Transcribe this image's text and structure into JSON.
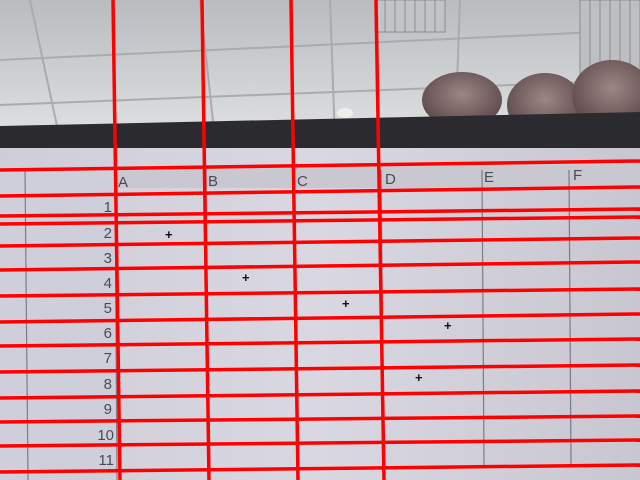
{
  "spreadsheet": {
    "column_headers": [
      "A",
      "B",
      "C",
      "D",
      "E",
      "F"
    ],
    "row_headers": [
      "1",
      "2",
      "3",
      "4",
      "5",
      "6",
      "7",
      "8",
      "9",
      "10",
      "11"
    ],
    "markers": [
      {
        "cell": "A2",
        "symbol": "+"
      },
      {
        "cell": "B4",
        "symbol": "+"
      },
      {
        "cell": "C5",
        "symbol": "+"
      },
      {
        "cell": "D6",
        "symbol": "+"
      },
      {
        "cell": "D8",
        "symbol": "+"
      }
    ]
  },
  "overlay": {
    "line_color": "#ff0000",
    "description_color_grid": "#3a3a46"
  },
  "colors": {
    "ceiling": "#c9cccf",
    "tile_grid": "#a9abae",
    "monitor_bezel": "#2b2b2f",
    "sheet_background": "#d4d3dc",
    "header_text": "#4a4a55",
    "fingers": "#6e5a5a"
  }
}
